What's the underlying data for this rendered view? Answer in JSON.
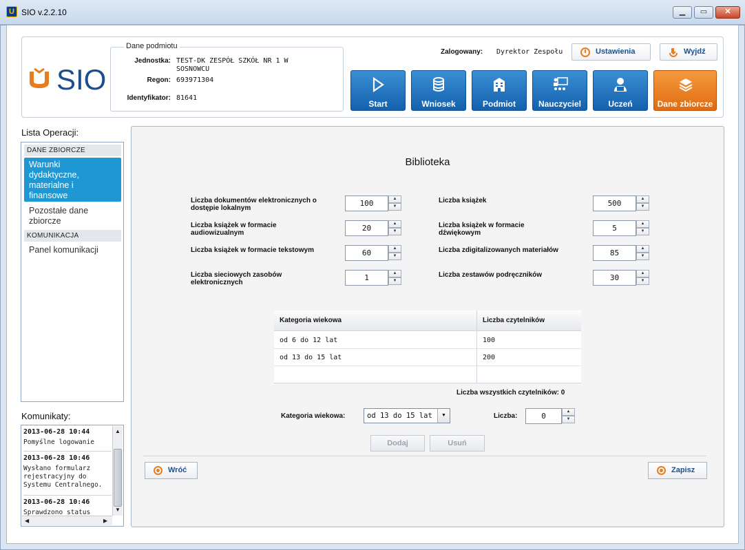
{
  "window": {
    "title": "SIO v.2.2.10",
    "min": "▁",
    "max": "▭",
    "close": "✕"
  },
  "logo": {
    "text": "SIO"
  },
  "entity": {
    "legend": "Dane podmiotu",
    "unit_label": "Jednostka:",
    "unit_value_line1": "TEST-DK ZESPÓŁ SZKÓŁ NR 1 W",
    "unit_value_line2": "SOSNOWCU",
    "regon_label": "Regon:",
    "regon_value": "693971304",
    "id_label": "Identyfikator:",
    "id_value": "81641"
  },
  "header": {
    "logged_label": "Zalogowany:",
    "logged_value": "Dyrektor Zespołu",
    "settings_label": "Ustawienia",
    "logout_label": "Wyjdź"
  },
  "tiles": [
    {
      "label": "Start",
      "icon": "play-icon"
    },
    {
      "label": "Wniosek",
      "icon": "database-icon"
    },
    {
      "label": "Podmiot",
      "icon": "building-icon"
    },
    {
      "label": "Nauczyciel",
      "icon": "teacher-icon"
    },
    {
      "label": "Uczeń",
      "icon": "student-icon"
    },
    {
      "label": "Dane zbiorcze",
      "icon": "books-icon",
      "active": true
    }
  ],
  "sidebar": {
    "title": "Lista Operacji:",
    "sections": [
      {
        "head": "DANE ZBIORCZE"
      },
      {
        "head": "KOMUNIKACJA"
      }
    ],
    "items": [
      {
        "label_lines": [
          "Warunki",
          "dydaktyczne,",
          "materialne i",
          "finansowe"
        ]
      },
      {
        "label_lines": [
          "Pozostałe dane",
          "zbiorcze"
        ]
      },
      {
        "label_lines": [
          "Panel komunikacji"
        ]
      }
    ]
  },
  "messages": {
    "title": "Komunikaty:",
    "list": [
      {
        "ts": "2013-06-28 10:44",
        "lines": [
          "Pomyślne logowanie"
        ]
      },
      {
        "ts": "2013-06-28 10:46",
        "lines": [
          "Wysłano formularz",
          "rejestracyjny do",
          "Systemu Centralnego."
        ]
      },
      {
        "ts": "2013-06-28 10:46",
        "lines": [
          "Sprawdzono status"
        ]
      }
    ]
  },
  "page": {
    "title": "Biblioteka",
    "fields_left": [
      {
        "label": [
          "Liczba dokumentów elektronicznych o",
          "dostępie lokalnym"
        ],
        "value": "100"
      },
      {
        "label": [
          "Liczba książek w formacie",
          "audiowizualnym"
        ],
        "value": "20"
      },
      {
        "label": [
          "Liczba książek w formacie tekstowym"
        ],
        "value": "60"
      },
      {
        "label": [
          "Liczba sieciowych zasobów",
          "elektronicznych"
        ],
        "value": "1"
      }
    ],
    "fields_right": [
      {
        "label": [
          "Liczba książek"
        ],
        "value": "500"
      },
      {
        "label": [
          "Liczba książek w formacie",
          "dźwiękowym"
        ],
        "value": "5"
      },
      {
        "label": [
          "Liczba zdigitalizowanych materiałów"
        ],
        "value": "85"
      },
      {
        "label": [
          "Liczba zestawów podręczników"
        ],
        "value": "30"
      }
    ],
    "table": {
      "headers": [
        "Kategoria wiekowa",
        "Liczba czytelników"
      ],
      "rows": [
        [
          "od 6 do 12 lat",
          "100"
        ],
        [
          "od 13 do 15 lat",
          "200"
        ]
      ]
    },
    "total_readers": "Liczba wszystkich czytelników: 0",
    "category_label": "Kategoria wiekowa:",
    "category_value": "od 13 do 15 lat",
    "count_label": "Liczba:",
    "count_value": "0",
    "add_label": "Dodaj",
    "remove_label": "Usuń",
    "back_label": "Wróć",
    "save_label": "Zapisz"
  },
  "colors": {
    "accent_blue": "#1f97d2",
    "brand_blue": "#1c4d8c",
    "brand_orange": "#e87d1e"
  }
}
